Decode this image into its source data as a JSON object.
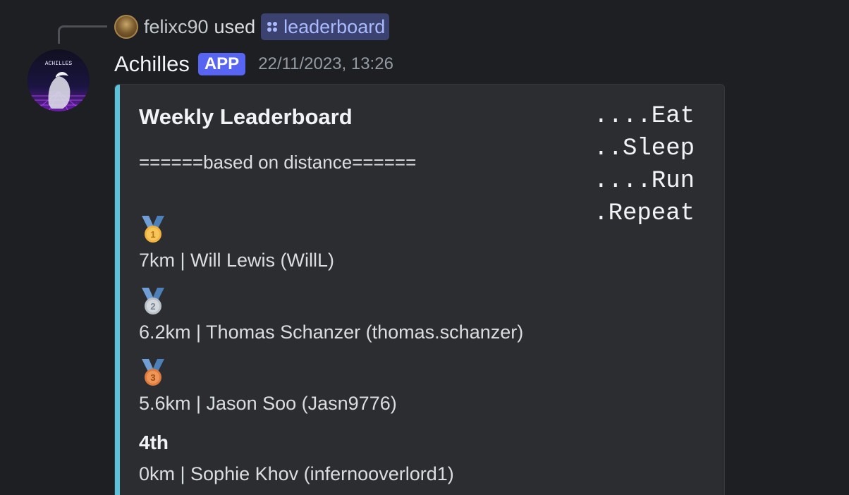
{
  "reply": {
    "user": "felixc90",
    "used_text": "used",
    "command": "leaderboard"
  },
  "message": {
    "author": "Achilles",
    "badge": "APP",
    "timestamp": "22/11/2023, 13:26",
    "avatar_text": "ACHILLES"
  },
  "embed": {
    "accent_color": "#5bc2d9",
    "title": "Weekly Leaderboard",
    "subtitle": "======based on distance======",
    "motto": [
      "....Eat",
      "..Sleep",
      "....Run",
      ".Repeat"
    ],
    "entries": [
      {
        "place_icon": "first-place-medal-icon",
        "text": "7km | Will Lewis (WillL)"
      },
      {
        "place_icon": "second-place-medal-icon",
        "text": "6.2km | Thomas Schanzer (thomas.schanzer)"
      },
      {
        "place_icon": "third-place-medal-icon",
        "text": "5.6km | Jason Soo (Jasn9776)"
      },
      {
        "place_label": "4th",
        "text": "0km | Sophie Khov (infernooverlord1)"
      }
    ]
  }
}
